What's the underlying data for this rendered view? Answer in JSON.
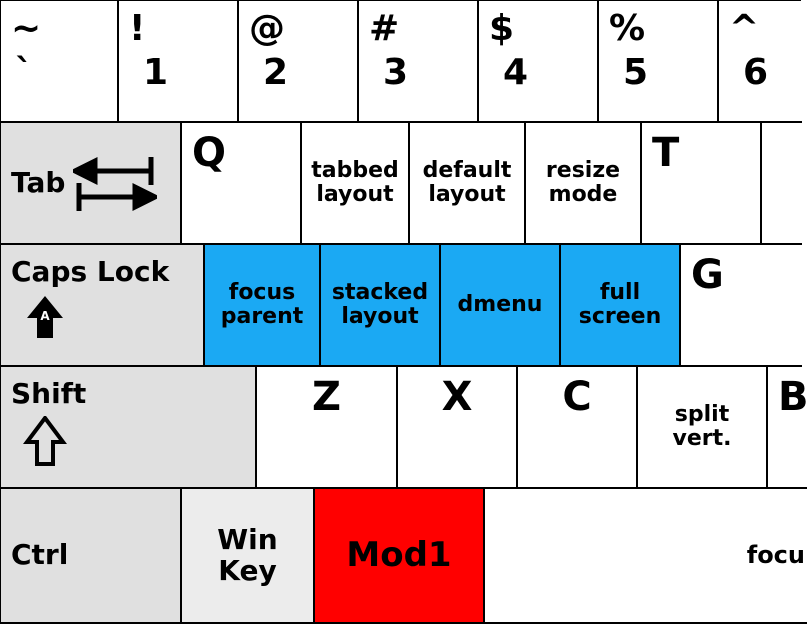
{
  "row_number": {
    "keys": [
      {
        "upper": "~",
        "lower": "`"
      },
      {
        "upper": "!",
        "lower": "1"
      },
      {
        "upper": "@",
        "lower": "2"
      },
      {
        "upper": "#",
        "lower": "3"
      },
      {
        "upper": "$",
        "lower": "4"
      },
      {
        "upper": "%",
        "lower": "5"
      },
      {
        "upper": "^",
        "lower": "6"
      }
    ]
  },
  "row_q": {
    "tab_label": "Tab",
    "q": "Q",
    "tabbed_layout_l1": "tabbed",
    "tabbed_layout_l2": "layout",
    "default_layout_l1": "default",
    "default_layout_l2": "layout",
    "resize_mode_l1": "resize",
    "resize_mode_l2": "mode",
    "t": "T"
  },
  "row_a": {
    "capslock_label": "Caps Lock",
    "focus_parent_l1": "focus",
    "focus_parent_l2": "parent",
    "stacked_layout_l1": "stacked",
    "stacked_layout_l2": "layout",
    "dmenu": "dmenu",
    "full_screen_l1": "full",
    "full_screen_l2": "screen",
    "g": "G"
  },
  "row_z": {
    "shift_label": "Shift",
    "z": "Z",
    "x": "X",
    "c": "C",
    "split_vert_l1": "split",
    "split_vert_l2": "vert.",
    "b_partial": "B"
  },
  "row_ctrl": {
    "ctrl_label": "Ctrl",
    "win_key_l1": "Win",
    "win_key_l2": "Key",
    "mod1_label": "Mod1",
    "focus_partial": "focu"
  },
  "colors": {
    "blue": "#1ba9f3",
    "red": "#ff0000",
    "grey": "#e0e0e0"
  }
}
